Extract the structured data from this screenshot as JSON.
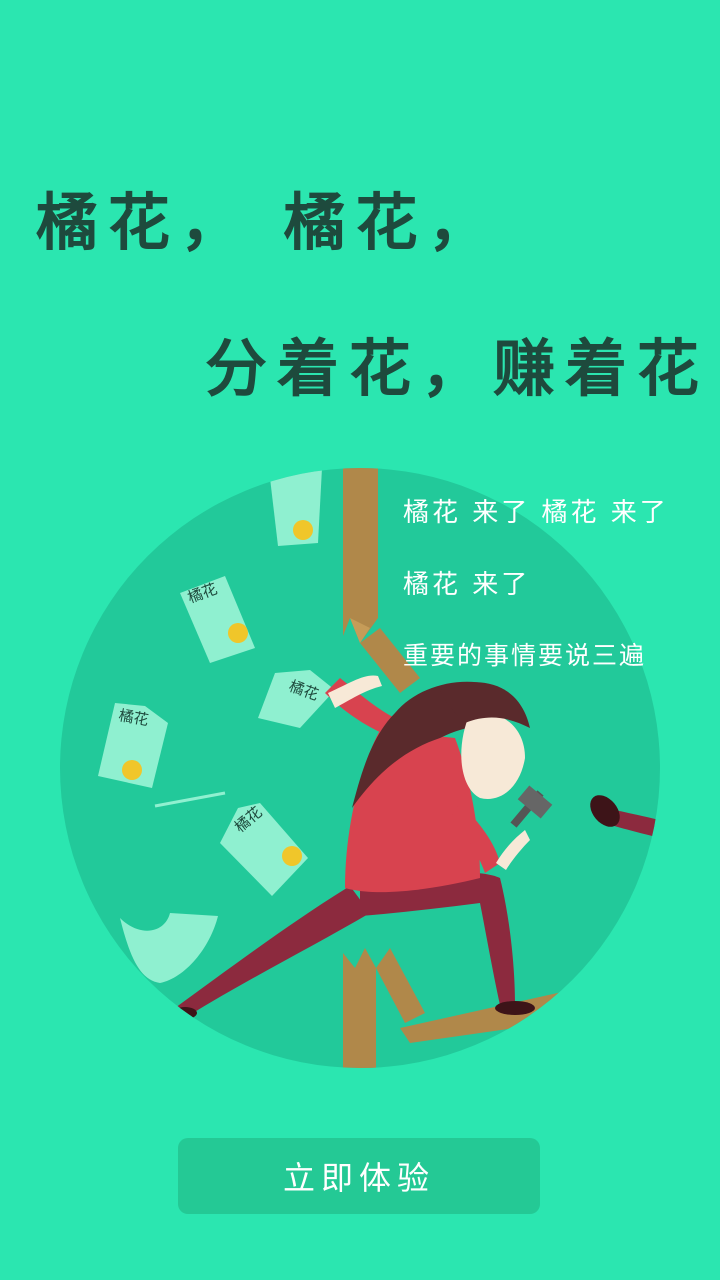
{
  "headline": {
    "line1": "橘花，  橘花，",
    "line2": "分着花，赚着花"
  },
  "captions": [
    "橘花 来了 橘花 来了",
    "橘花 来了",
    "重要的事情要说三遍"
  ],
  "paper_labels": [
    "橘花",
    "橘花",
    "橘花",
    "橘花"
  ],
  "cta": {
    "label": "立即体验"
  },
  "colors": {
    "background": "#2be6b0",
    "circle": "#22c99a",
    "headline_text": "#1e4a3d",
    "shirt": "#d8434f",
    "pants": "#8c2a3e",
    "hair": "#5a2a2c",
    "wood": "#b0884a",
    "paper": "#8ff0d0",
    "coin": "#f0c62a"
  }
}
